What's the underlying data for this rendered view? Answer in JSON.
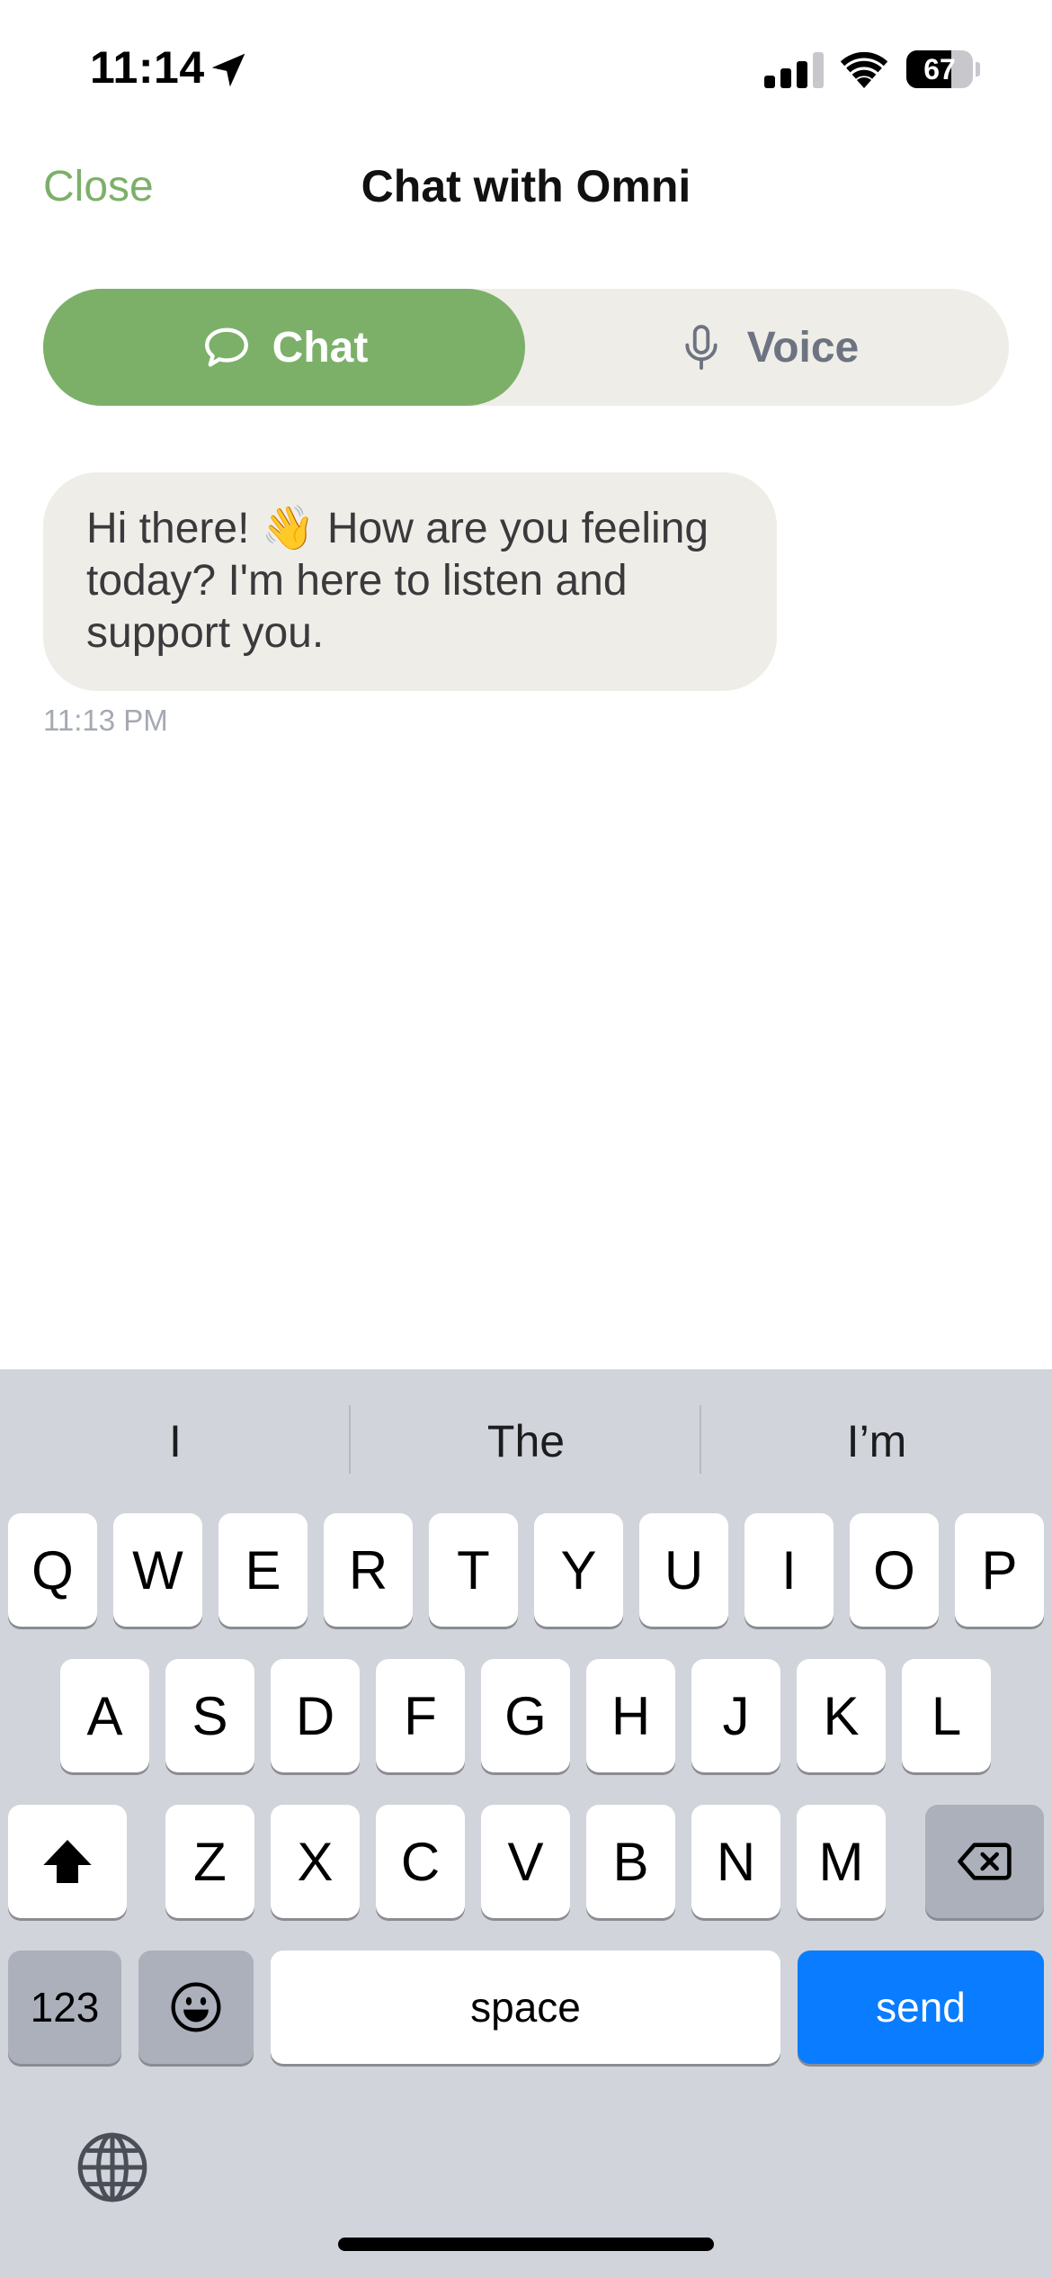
{
  "status_bar": {
    "time": "11:14",
    "battery_level": "67",
    "battery_fraction": 0.67,
    "icons": [
      "location-arrow-icon",
      "cellular-signal-icon",
      "wifi-icon",
      "battery-icon"
    ]
  },
  "nav": {
    "close_label": "Close",
    "title": "Chat with Omni"
  },
  "mode_switch": {
    "chat_label": "Chat",
    "voice_label": "Voice",
    "selected": "Chat"
  },
  "messages": [
    {
      "text": "Hi there! 👋 How are you feeling today? I'm here to listen and support you.",
      "time": "11:13 PM"
    }
  ],
  "keyboard": {
    "suggestions": [
      "I",
      "The",
      "I’m"
    ],
    "row1": [
      "Q",
      "W",
      "E",
      "R",
      "T",
      "Y",
      "U",
      "I",
      "O",
      "P"
    ],
    "row2": [
      "A",
      "S",
      "D",
      "F",
      "G",
      "H",
      "J",
      "K",
      "L"
    ],
    "row3": [
      "Z",
      "X",
      "C",
      "V",
      "B",
      "N",
      "M"
    ],
    "numbers_label": "123",
    "space_label": "space",
    "send_label": "send"
  },
  "colors": {
    "accent": "#7cb069",
    "send": "#0a7cff",
    "bubble": "#efede8",
    "keyboard": "#d1d4da"
  }
}
